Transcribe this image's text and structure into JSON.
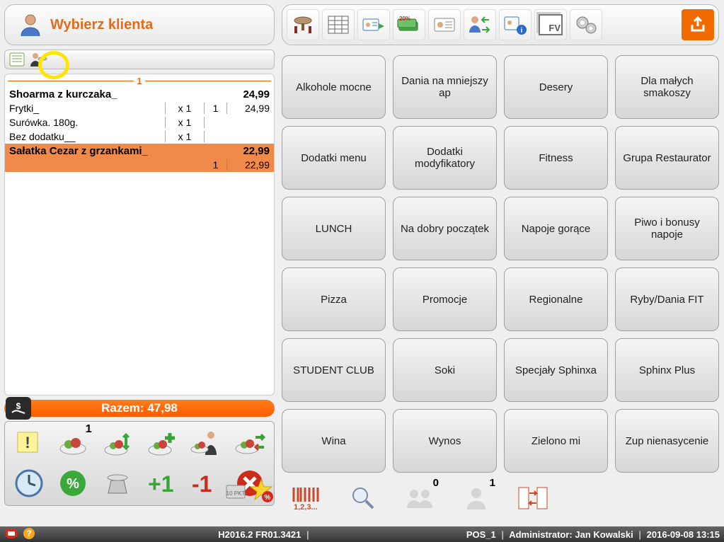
{
  "header": {
    "select_customer": "Wybierz klienta"
  },
  "ticket": {
    "sequence": "1",
    "lines": [
      {
        "type": "main",
        "name": "Shoarma z kurczaka_",
        "qty": "",
        "grp": "",
        "price": "24,99"
      },
      {
        "type": "sub",
        "name": "Frytki_",
        "qty": "x 1",
        "grp": "1",
        "price": "24,99"
      },
      {
        "type": "sub",
        "name": "Surówka. 180g.",
        "qty": "x 1",
        "grp": "",
        "price": ""
      },
      {
        "type": "sub",
        "name": "Bez dodatku__",
        "qty": "x 1",
        "grp": "",
        "price": ""
      },
      {
        "type": "main",
        "name": "Sałatka Cezar z grzankami_",
        "qty": "",
        "grp": "",
        "price": "22,99",
        "selected": true
      },
      {
        "type": "sub",
        "name": "",
        "qty": "",
        "grp": "1",
        "price": "22,99",
        "selected": true
      }
    ]
  },
  "total": {
    "label": "Razem:",
    "value": "47,98"
  },
  "actions": {
    "note_badge": "1"
  },
  "categories": [
    "Alkohole mocne",
    "Dania na mniejszy ap",
    "Desery",
    "Dla małych smakoszy",
    "Dodatki menu",
    "Dodatki modyfikatory",
    "Fitness",
    "Grupa Restaurator",
    "LUNCH",
    "Na dobry początek",
    "Napoje gorące",
    "Piwo i bonusy napoje",
    "Pizza",
    "Promocje",
    "Regionalne",
    "Ryby/Dania FIT",
    "STUDENT CLUB",
    "Soki",
    "Specjały Sphinxa",
    "Sphinx Plus",
    "Wina",
    "Wynos",
    "Zielono mi",
    "Zup nienasycenie"
  ],
  "right_bottom": {
    "barcode_label": "1,2,3...",
    "group_badge": "0",
    "user_badge": "1"
  },
  "status": {
    "version": "H2016.2 FR01.3421",
    "pos": "POS_1",
    "role": "Administrator",
    "user": "Jan Kowalski",
    "datetime": "2016-09-08 13:15"
  }
}
